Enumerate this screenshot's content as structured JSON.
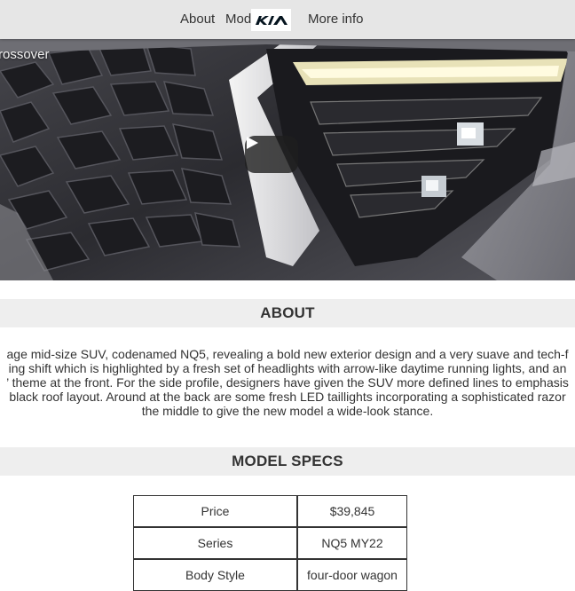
{
  "nav": {
    "about_label": "About",
    "models_label": "Models",
    "more_info_label": "More info",
    "logo_text": "KIA"
  },
  "hero": {
    "caption": "rossover",
    "play_icon": "play-icon"
  },
  "about": {
    "heading": "ABOUT",
    "lines": [
      "age mid-size SUV, codenamed NQ5, revealing a bold new exterior design and a very suave and tech-f",
      "ing shift which is highlighted by a fresh set of headlights with arrow-like daytime running lights, and an",
      "’ theme at the front. For the side profile, designers have given the SUV more defined lines to emphasis",
      "black roof layout. Around at the back are some fresh LED taillights incorporating a sophisticated razor",
      "the middle to give the new model a wide-look stance."
    ]
  },
  "specs": {
    "heading": "MODEL SPECS",
    "rows": [
      {
        "label": "Price",
        "value": "$39,845"
      },
      {
        "label": "Series",
        "value": "NQ5 MY22"
      },
      {
        "label": "Body Style",
        "value": "four-door wagon"
      }
    ]
  },
  "colors": {
    "header_bg": "#e6e6e6",
    "section_bg": "#eeeeee"
  }
}
